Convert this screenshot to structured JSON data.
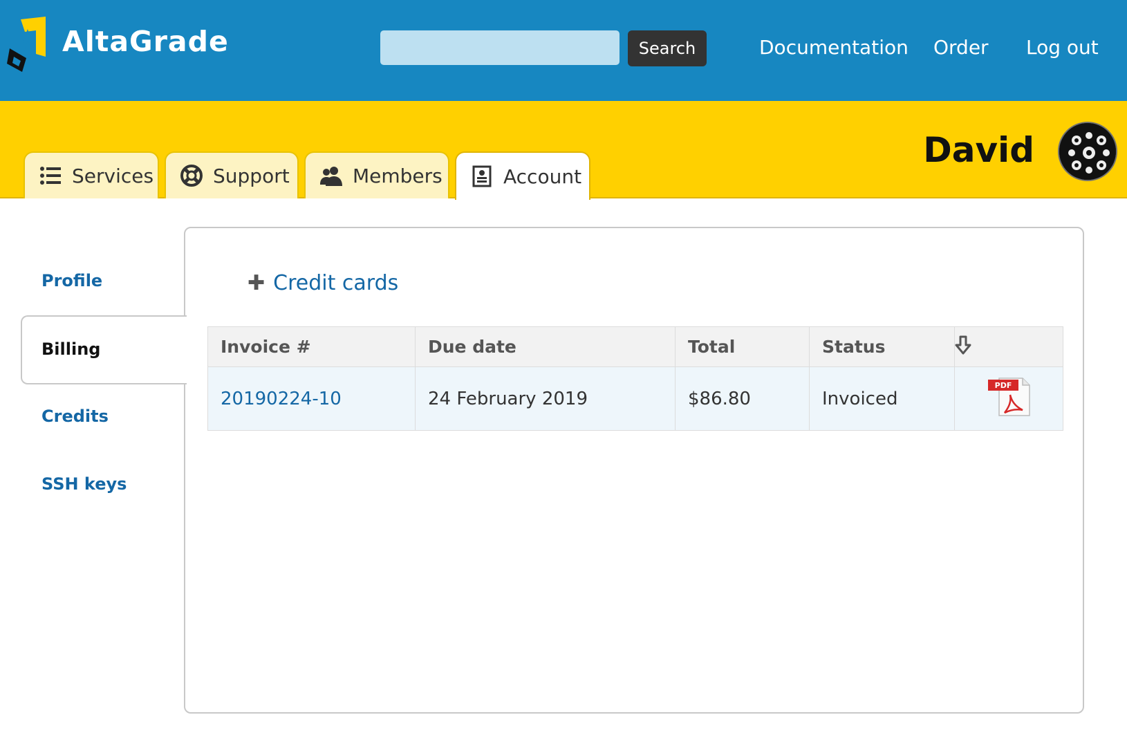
{
  "brand": {
    "name": "AltaGrade"
  },
  "search": {
    "placeholder": "",
    "button_label": "Search"
  },
  "nav": {
    "documentation": "Documentation",
    "order": "Order",
    "logout": "Log out"
  },
  "tabs": [
    {
      "label": "Services",
      "icon": "list-icon"
    },
    {
      "label": "Support",
      "icon": "lifebuoy-icon"
    },
    {
      "label": "Members",
      "icon": "members-icon"
    },
    {
      "label": "Account",
      "icon": "account-icon",
      "active": true
    }
  ],
  "user": {
    "name": "David"
  },
  "sidebar": {
    "items": [
      {
        "label": "Profile"
      },
      {
        "label": "Billing",
        "active": true
      },
      {
        "label": "Credits"
      },
      {
        "label": "SSH keys"
      }
    ]
  },
  "billing": {
    "credit_cards_link": "Credit cards",
    "columns": [
      "Invoice #",
      "Due date",
      "Total",
      "Status"
    ],
    "rows": [
      {
        "invoice": "20190224-10",
        "due_date": "24 February 2019",
        "total": "$86.80",
        "status": "Invoiced",
        "pdf_badge": "PDF"
      }
    ]
  },
  "colors": {
    "header_blue": "#1787c1",
    "accent_yellow": "#ffd000",
    "link_blue": "#1467a5"
  }
}
